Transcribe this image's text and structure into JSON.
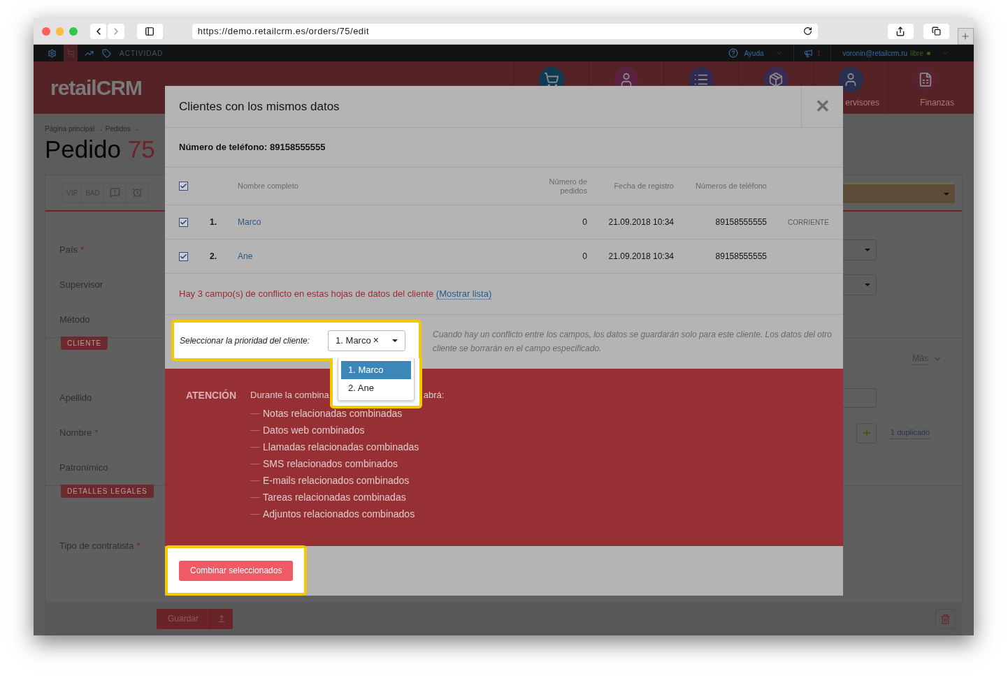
{
  "browser": {
    "url": "https://demo.retailcrm.es/orders/75/edit"
  },
  "topbar": {
    "section": "ACTIVIDAD",
    "help": "Ayuda",
    "notifications": "1",
    "user": "voronin@retailcrm.ru",
    "plan": "libre"
  },
  "header": {
    "logo": "retailCRM",
    "nav": [
      {
        "kind": "cart"
      },
      {
        "kind": "person"
      },
      {
        "kind": "list"
      },
      {
        "kind": "box"
      },
      {
        "kind": "woman",
        "label": "ervisores"
      },
      {
        "kind": "finance",
        "label": "Finanzas"
      }
    ]
  },
  "breadcrumb": "Página principal → Pedidos →",
  "order": {
    "title": "Pedido",
    "number": "75"
  },
  "tags": [
    "VIP",
    "BAD"
  ],
  "rows": [
    {
      "label": "País",
      "required_mark": "*",
      "kind": "select"
    },
    {
      "label": "Supervisor",
      "kind": "select"
    },
    {
      "label": "Método",
      "kind": "plain"
    },
    {
      "section": "CLIENTE",
      "kind": "section",
      "more": "Más"
    },
    {
      "label": "Apellido",
      "kind": "input"
    },
    {
      "label": "Nombre",
      "required_mark": "*",
      "kind": "duplicate",
      "duplicate": "1 duplicado"
    },
    {
      "label": "Patronímico",
      "kind": "plain"
    },
    {
      "section": "DETALLES LEGALES",
      "kind": "section"
    },
    {
      "label": "Tipo de contratista",
      "required_mark": "*",
      "kind": "plain"
    }
  ],
  "save_button": "Guardar",
  "modal": {
    "title": "Clientes con los mismos datos",
    "close": "✕",
    "phone": "Número de teléfono: 89158555555",
    "all_checked": true,
    "columns": [
      "Nombre completo",
      "Número de pedidos",
      "Fecha de registro",
      "Números de teléfono"
    ],
    "clients": [
      {
        "number": "1.",
        "name": "Marco",
        "orders": "0",
        "registered": "21.09.2018 10:34",
        "phone": "89158555555",
        "badge": "CORRIENTE",
        "checked": true
      },
      {
        "number": "2.",
        "name": "Ane",
        "orders": "0",
        "registered": "21.09.2018 10:34",
        "phone": "89158555555",
        "checked": true
      }
    ],
    "conflict": "Hay 3 campo(s) de conflicto en estas hojas de datos del cliente",
    "conflict_link": "(Mostrar lista)",
    "priority_label": "Seleccionar la prioridad del cliente:",
    "priority_value": "1. Marco",
    "clear": "×",
    "options": [
      {
        "label": "1. Marco",
        "selected": true
      },
      {
        "label": "2. Ane",
        "selected": false
      }
    ],
    "note": "Cuando hay un conflicto entre los campos, los datos se guardarán solo para este cliente. Los datos del otro cliente se borrarán en el campo especificado.",
    "attention_title": "ATENCIÓN",
    "attention_intro_start": "Durante la combina",
    "attention_intro_end": "abrá:",
    "attention_items": [
      "Notas relacionadas combinadas",
      "Datos web combinados",
      "Llamadas relacionadas combinadas",
      "SMS relacionados combinados",
      "E-mails relacionados combinados",
      "Tareas relacionadas combinadas",
      "Adjuntos relacionados combinados"
    ],
    "merge_button": "Combinar seleccionados"
  }
}
